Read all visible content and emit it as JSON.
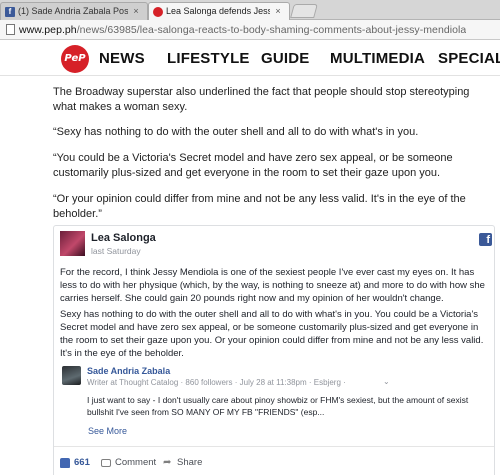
{
  "browser": {
    "tabs": [
      {
        "label": "(1) Sade Andria Zabala Pos",
        "close": "×"
      },
      {
        "label": "Lea Salonga defends Jessy",
        "close": "×"
      }
    ],
    "fb_favicon": "f",
    "url_host": "www.pep.ph",
    "url_path": "/news/63985/lea-salonga-reacts-to-body-shaming-comments-about-jessy-mendiola"
  },
  "site_nav": {
    "logo": "PeP",
    "items": [
      "NEWS",
      "LIFESTYLE",
      "GUIDE",
      "MULTIMEDIA",
      "SPECIALS"
    ]
  },
  "article": {
    "paragraphs": [
      "The Broadway superstar also underlined the fact that people should stop stereotyping what makes a woman sexy.",
      "“Sexy has nothing to do with the outer shell and all to do with what's in you.",
      "“You could be a Victoria's Secret model and have zero sex appeal, or be someone customarily plus-sized and get everyone in the room to set their gaze upon you.",
      "“Or your opinion could differ from mine and not be any less valid. It's in the eye of the beholder.”"
    ]
  },
  "fb_post": {
    "author": "Lea Salonga",
    "time": "last Saturday",
    "fb_logo": "f",
    "paragraphs": [
      "For the record, I think Jessy Mendiola is one of the sexiest people I've ever cast my eyes on. It has less to do with her physique (which, by the way, is nothing to sneeze at) and more to do with how she carries herself. She could gain 20 pounds right now and my opinion of her wouldn't change.",
      "Sexy has nothing to do with the outer shell and all to do with what's in you. You could be a Victoria's Secret model and have zero sex appeal, or be someone customarily plus-sized and get everyone in the room to set their gaze upon you. Or your opinion could differ from mine and not be any less valid. It's in the eye of the beholder."
    ],
    "reply": {
      "name": "Sade Andria Zabala",
      "meta": "Writer at Thought Catalog · 860 followers · July 28 at 11:38pm · Esbjerg ·",
      "text": "I just want to say - I don't usually care about pinoy showbiz or FHM's sexiest, but the amount of sexist bullshit I've seen from SO MANY OF MY FB \"FRIENDS\" (esp...",
      "see_more": "See More"
    },
    "actions": {
      "like_count": "661",
      "comment": "Comment",
      "share": "Share"
    }
  },
  "colors": {
    "pep_red": "#d62128",
    "fb_blue": "#3b5998",
    "link_blue": "#365899"
  }
}
